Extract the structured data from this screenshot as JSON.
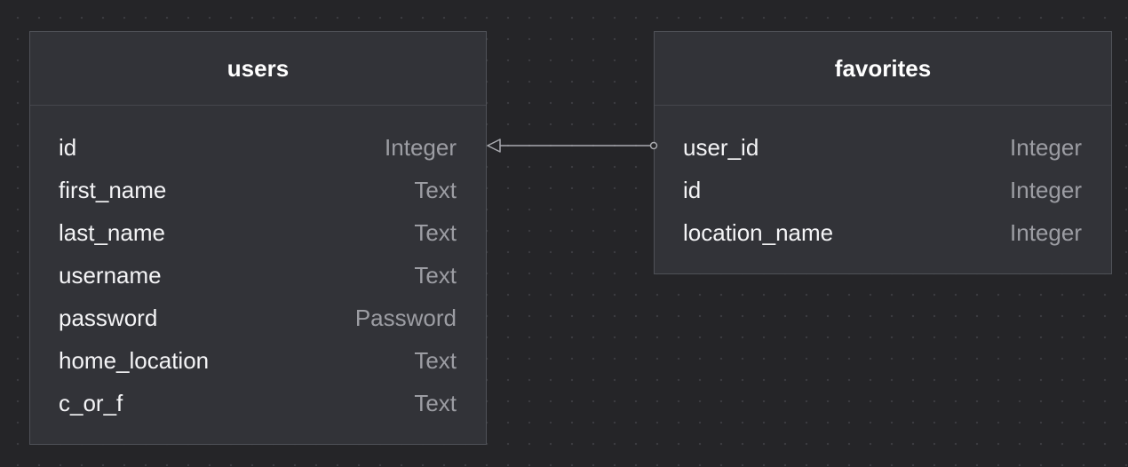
{
  "tables": {
    "users": {
      "name": "users",
      "columns": [
        {
          "name": "id",
          "type": "Integer"
        },
        {
          "name": "first_name",
          "type": "Text"
        },
        {
          "name": "last_name",
          "type": "Text"
        },
        {
          "name": "username",
          "type": "Text"
        },
        {
          "name": "password",
          "type": "Password"
        },
        {
          "name": "home_location",
          "type": "Text"
        },
        {
          "name": "c_or_f",
          "type": "Text"
        }
      ]
    },
    "favorites": {
      "name": "favorites",
      "columns": [
        {
          "name": "user_id",
          "type": "Integer"
        },
        {
          "name": "id",
          "type": "Integer"
        },
        {
          "name": "location_name",
          "type": "Integer"
        }
      ]
    }
  },
  "relationship": {
    "from": "favorites.user_id",
    "to": "users.id"
  },
  "colors": {
    "canvas": "#252528",
    "table_bg": "#323338",
    "border": "#4f5157",
    "text": "#f4f4f6",
    "type_text": "#9c9da3",
    "connector": "#a9aaaf"
  }
}
